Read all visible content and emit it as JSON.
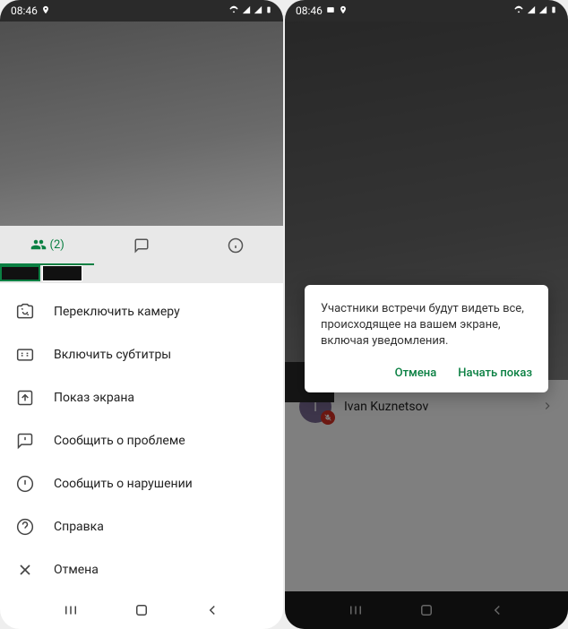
{
  "status": {
    "time": "08:46",
    "time2": "08:46"
  },
  "screen1": {
    "participants_count": "(2)",
    "menu": {
      "switch_camera": "Переключить камеру",
      "captions": "Включить субтитры",
      "share_screen": "Показ экрана",
      "report_problem": "Сообщить о проблеме",
      "report_abuse": "Сообщить о нарушении",
      "help": "Справка",
      "cancel": "Отмена"
    }
  },
  "screen2": {
    "dialog": {
      "text": "Участники встречи будут видеть все, происходящее на вашем экране, включая уведомления.",
      "cancel": "Отмена",
      "start": "Начать показ"
    },
    "participant": {
      "initial": "I",
      "name": "Ivan Kuznetsov"
    }
  }
}
